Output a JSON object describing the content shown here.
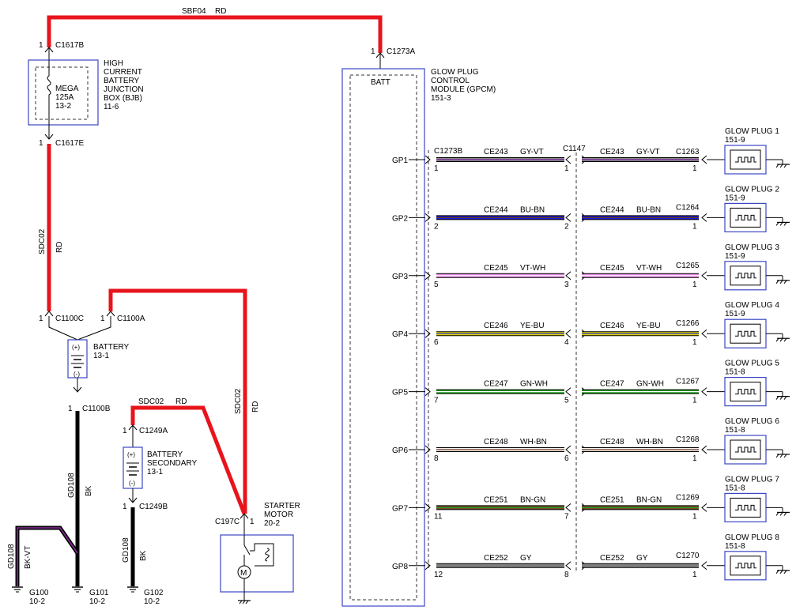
{
  "top_wire": {
    "circuit": "SBF04",
    "color": "RD"
  },
  "bjb": {
    "conn_top": "C1617B",
    "pin_top": "1",
    "conn_bot": "C1617E",
    "pin_bot": "1",
    "title": [
      "HIGH",
      "CURRENT",
      "BATTERY",
      "JUNCTION",
      "BOX (BJB)",
      "11-6"
    ],
    "fuse": [
      "MEGA",
      "125A",
      "13-2"
    ]
  },
  "left_wire": {
    "circuit": "SDC02",
    "color": "RD"
  },
  "battery": {
    "conn_c": "C1100C",
    "pin_c": "1",
    "conn_a": "C1100A",
    "pin_a": "1",
    "conn_b": "C1100B",
    "pin_b": "1",
    "title": [
      "BATTERY",
      "13-1"
    ],
    "plus": "(+)",
    "minus": "(-)"
  },
  "gd_left": {
    "circuit": "GD108",
    "color": "BK"
  },
  "gd_bkvt": {
    "circuit": "GD108",
    "color": "BK-VT"
  },
  "grounds": [
    {
      "name": "G100",
      "ref": "10-2"
    },
    {
      "name": "G101",
      "ref": "10-2"
    },
    {
      "name": "G102",
      "ref": "10-2"
    }
  ],
  "secondary_wire": {
    "circuit": "SDC02",
    "color": "RD"
  },
  "battery_secondary": {
    "conn_a": "C1249A",
    "pin_a": "1",
    "conn_b": "C1249B",
    "pin_b": "1",
    "title": [
      "BATTERY",
      "SECONDARY",
      "13-1"
    ],
    "plus": "(+)",
    "minus": "(-)"
  },
  "gd_mid": {
    "circuit": "GD108",
    "color": "BK"
  },
  "starter_wire": {
    "circuit": "SDC02",
    "color": "RD"
  },
  "starter": {
    "conn": "C197C",
    "pin": "1",
    "title": [
      "STARTER",
      "MOTOR",
      "20-2"
    ],
    "motor": "M"
  },
  "gpcm": {
    "conn": "C1273A",
    "pin": "1",
    "batt": "BATT",
    "title": [
      "GLOW PLUG",
      "CONTROL",
      "MODULE (GPCM)",
      "151-3"
    ],
    "conn_left": "C1273B",
    "conn_mid": "C1147"
  },
  "channels": [
    {
      "gp": "GP1",
      "circuit": "CE243",
      "color": "GY-VT",
      "pin_l": "1",
      "pin_m": "1",
      "conn_r": "C1263",
      "pin_r": "1",
      "plug": "GLOW PLUG 1",
      "ref": "151-9",
      "main": "#8a8a8a",
      "stripe": "#7a1f9e"
    },
    {
      "gp": "GP2",
      "circuit": "CE244",
      "color": "BU-BN",
      "pin_l": "2",
      "pin_m": "2",
      "conn_r": "C1264",
      "pin_r": "1",
      "plug": "GLOW PLUG 2",
      "ref": "151-9",
      "main": "#1a1ad6",
      "stripe": "#6b3a1a"
    },
    {
      "gp": "GP3",
      "circuit": "CE245",
      "color": "VT-WH",
      "pin_l": "5",
      "pin_m": "3",
      "conn_r": "C1265",
      "pin_r": "1",
      "plug": "GLOW PLUG 3",
      "ref": "151-9",
      "main": "#e58ae5",
      "stripe": "#ffffff"
    },
    {
      "gp": "GP4",
      "circuit": "CE246",
      "color": "YE-BU",
      "pin_l": "6",
      "pin_m": "4",
      "conn_r": "C1266",
      "pin_r": "1",
      "plug": "GLOW PLUG 4",
      "ref": "151-9",
      "main": "#e8e000",
      "stripe": "#1a1ad6"
    },
    {
      "gp": "GP5",
      "circuit": "CE247",
      "color": "GN-WH",
      "pin_l": "7",
      "pin_m": "5",
      "conn_r": "C1267",
      "pin_r": "1",
      "plug": "GLOW PLUG 5",
      "ref": "151-8",
      "main": "#1e9e1e",
      "stripe": "#ffffff"
    },
    {
      "gp": "GP6",
      "circuit": "CE248",
      "color": "WH-BN",
      "pin_l": "8",
      "pin_m": "6",
      "conn_r": "C1268",
      "pin_r": "1",
      "plug": "GLOW PLUG 6",
      "ref": "151-8",
      "main": "#f2f2f2",
      "stripe": "#6b3a1a"
    },
    {
      "gp": "GP7",
      "circuit": "CE251",
      "color": "BN-GN",
      "pin_l": "11",
      "pin_m": "7",
      "conn_r": "C1269",
      "pin_r": "1",
      "plug": "GLOW PLUG 7",
      "ref": "151-8",
      "main": "#7a4a2a",
      "stripe": "#1e9e1e"
    },
    {
      "gp": "GP8",
      "circuit": "CE252",
      "color": "GY",
      "pin_l": "12",
      "pin_m": "8",
      "conn_r": "C1270",
      "pin_r": "1",
      "plug": "GLOW PLUG 8",
      "ref": "151-8",
      "main": "#808080",
      "stripe": "#808080"
    }
  ],
  "colors": {
    "red": "#e8141c",
    "black": "#000000",
    "box": "#3b46c4",
    "bkvt_stripe": "#8a2a9a"
  }
}
